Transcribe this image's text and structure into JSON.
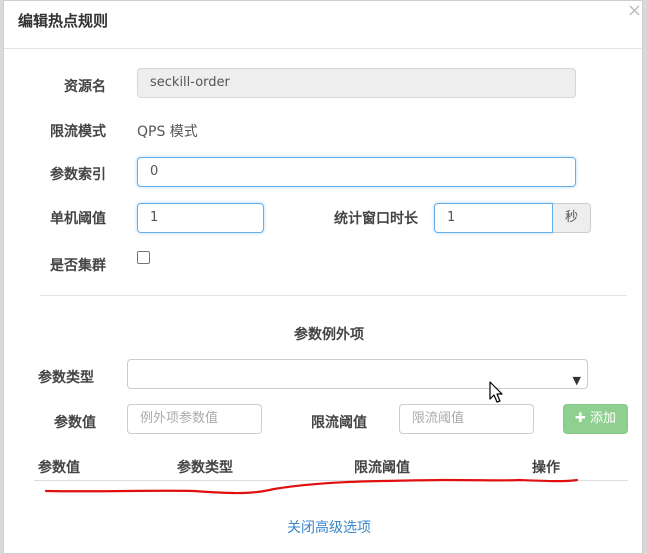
{
  "dialog": {
    "title": "编辑热点规则",
    "close_glyph": "×"
  },
  "form": {
    "resource_label": "资源名",
    "resource_value": "seckill-order",
    "mode_label": "限流模式",
    "mode_value": "QPS 模式",
    "param_index_label": "参数索引",
    "param_index_value": "0",
    "threshold_label": "单机阈值",
    "threshold_value": "1",
    "window_label": "统计窗口时长",
    "window_value": "1",
    "window_unit": "秒",
    "cluster_label": "是否集群",
    "cluster_checked": false
  },
  "exceptions": {
    "section_title": "参数例外项",
    "param_type_label": "参数类型",
    "param_type_value": "",
    "param_value_label": "参数值",
    "param_value_placeholder": "例外项参数值",
    "limit_label": "限流阈值",
    "limit_placeholder": "限流阈值",
    "add_button_icon": "plus-icon",
    "add_button_label": "添加"
  },
  "table": {
    "columns": [
      "参数值",
      "参数类型",
      "限流阈值",
      "操作"
    ],
    "rows": []
  },
  "footer": {
    "close_advanced_label": "关闭高级选项"
  },
  "colors": {
    "accent_blue": "#66afe9",
    "add_button_green": "#8fcf8f",
    "annotation_red": "#e01010",
    "link_blue": "#3a86c8"
  }
}
